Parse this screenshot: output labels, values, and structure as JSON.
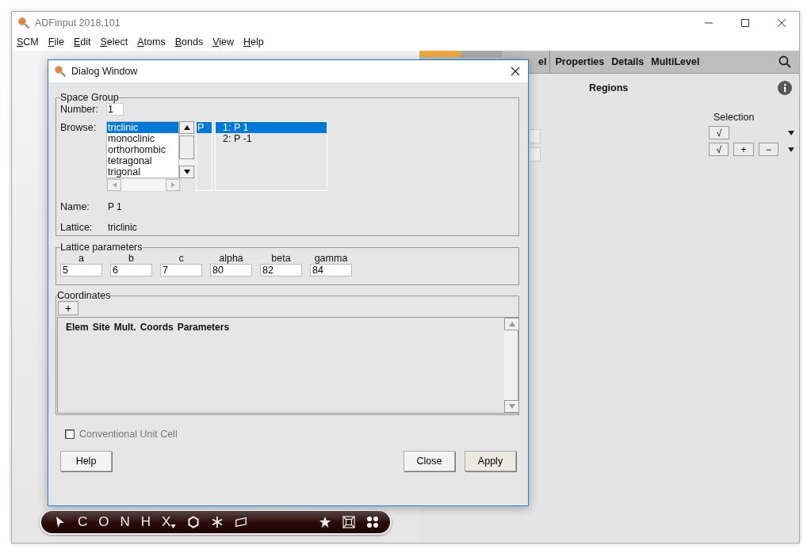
{
  "app": {
    "title": "ADFinput 2018.101",
    "menu": [
      "SCM",
      "File",
      "Edit",
      "Select",
      "Atoms",
      "Bonds",
      "View",
      "Help"
    ]
  },
  "panel": {
    "tabs": [
      "el",
      "Properties",
      "Details",
      "MultiLevel"
    ],
    "heading": "Regions",
    "selection_label": "Selection",
    "rows": [
      {
        "buttons": [
          "√"
        ]
      },
      {
        "buttons": [
          "√",
          "+",
          "−"
        ]
      }
    ]
  },
  "toolbar": {
    "elements": [
      "C",
      "O",
      "N",
      "H",
      "X"
    ]
  },
  "dialog": {
    "title": "Dialog Window",
    "space_group": {
      "legend": "Space Group",
      "number_label": "Number:",
      "number": "1",
      "browse_label": "Browse:",
      "systems": [
        {
          "label": "triclinic",
          "selected": true
        },
        {
          "label": "monoclinic",
          "selected": false
        },
        {
          "label": "orthorhombic",
          "selected": false
        },
        {
          "label": "tetragonal",
          "selected": false
        },
        {
          "label": "trigonal",
          "selected": false
        }
      ],
      "centering": [
        {
          "label": "P",
          "selected": true
        }
      ],
      "groups": [
        {
          "label": "1: P 1",
          "selected": true
        },
        {
          "label": "2: P -1",
          "selected": false
        }
      ],
      "name_label": "Name:",
      "name": "P 1",
      "lattice_label": "Lattice:",
      "lattice": "triclinic"
    },
    "lattice_parameters": {
      "legend": "Lattice parameters",
      "params": [
        {
          "label": "a",
          "value": "5"
        },
        {
          "label": "b",
          "value": "6"
        },
        {
          "label": "c",
          "value": "7"
        },
        {
          "label": "alpha",
          "value": "80"
        },
        {
          "label": "beta",
          "value": "82"
        },
        {
          "label": "gamma",
          "value": "84"
        }
      ]
    },
    "coordinates": {
      "legend": "Coordinates",
      "add": "+",
      "columns": [
        "Elem",
        "Site",
        "Mult.",
        "Coords",
        "Parameters"
      ]
    },
    "conventional_unit_cell": {
      "label": "Conventional Unit Cell",
      "checked": false,
      "disabled": true
    },
    "buttons": {
      "help": "Help",
      "close": "Close",
      "apply": "Apply"
    }
  }
}
